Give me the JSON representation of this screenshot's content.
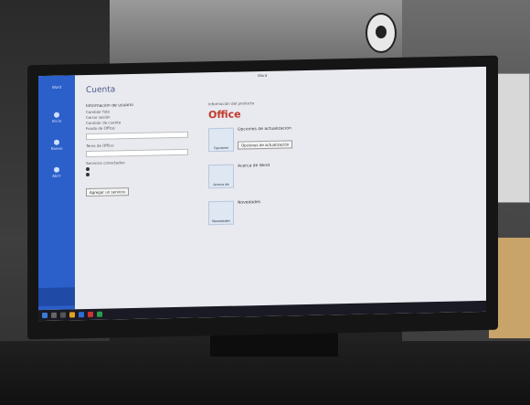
{
  "window": {
    "title": "Word",
    "right_status": ""
  },
  "backstage": {
    "title": "Cuenta",
    "nav": {
      "back_label": "Word",
      "items": [
        "Inicio",
        "Nuevo",
        "Abrir"
      ],
      "account_label": "Cuenta"
    },
    "left": {
      "lines": [
        "Información de usuario",
        "",
        "Cambiar foto",
        "Cerrar sesión",
        "Cambiar de cuenta",
        "Fondo de Office:",
        "",
        "Tema de Office:",
        "",
        "Servicios conectados:"
      ],
      "radio_options": [
        "",
        ""
      ],
      "add_service_button": "Agregar un servicio"
    },
    "right": {
      "header": "Información del producto",
      "brand": "Office",
      "products": [
        {
          "icon_label": "Opciones",
          "name": "Opciones de actualización",
          "desc": "",
          "button": "Opciones de actualización"
        },
        {
          "icon_label": "Acerca de",
          "name": "Acerca de Word",
          "desc": "",
          "button": ""
        },
        {
          "icon_label": "Novedades",
          "name": "Novedades",
          "desc": "",
          "button": ""
        }
      ]
    }
  },
  "taskbar": {
    "time": ""
  }
}
